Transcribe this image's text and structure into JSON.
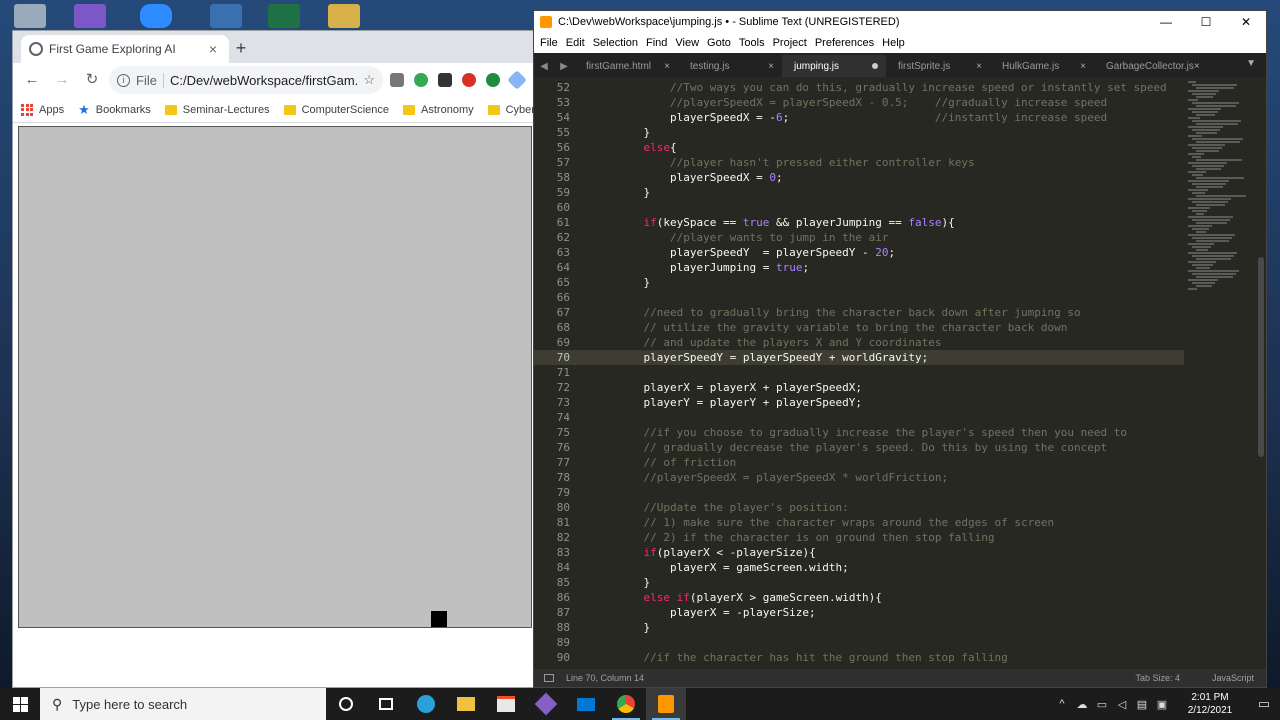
{
  "desktop": {
    "icons": [
      "recycle-bin-icon",
      "visual-studio-icon",
      "zoom-icon",
      "monitor-icon",
      "excel-icon",
      "folder-icon"
    ]
  },
  "chrome": {
    "tab_title": "First Game Exploring AI",
    "tab_close": "×",
    "new_tab": "+",
    "back": "←",
    "forward": "→",
    "reload": "↻",
    "address_label": "File",
    "address_url": "C:/Dev/webWorkspace/firstGam...",
    "bookmark_star": "☆",
    "bookmarks": [
      {
        "label": "Apps"
      },
      {
        "label": "Bookmarks"
      },
      {
        "label": "Seminar-Lectures"
      },
      {
        "label": "ComputerScience"
      },
      {
        "label": "Astronomy"
      },
      {
        "label": "Cybersecu"
      }
    ],
    "game": {
      "background": "#c0c0c0",
      "player_color": "#000000"
    }
  },
  "sublime": {
    "title": "C:\\Dev\\webWorkspace\\jumping.js • - Sublime Text (UNREGISTERED)",
    "window_controls": {
      "minimize": "—",
      "maximize": "☐",
      "close": "✕"
    },
    "menu": [
      "File",
      "Edit",
      "Selection",
      "Find",
      "View",
      "Goto",
      "Tools",
      "Project",
      "Preferences",
      "Help"
    ],
    "tab_nav": {
      "left": "◀",
      "right": "▶",
      "overflow": "▼"
    },
    "tabs": [
      {
        "label": "firstGame.html",
        "active": false
      },
      {
        "label": "testing.js",
        "active": false
      },
      {
        "label": "jumping.js",
        "active": true
      },
      {
        "label": "firstSprite.js",
        "active": false
      },
      {
        "label": "HulkGame.js",
        "active": false
      },
      {
        "label": "GarbageCollector.js",
        "active": false
      }
    ],
    "tab_close": "×",
    "code_lines": [
      {
        "n": "52",
        "text": "        //Two ways you can do this, gradually increase speed or instantly set speed"
      },
      {
        "n": "53",
        "text": "        //playerSpeedX = playerSpeedX - 0.5;    //gradually increase speed"
      },
      {
        "n": "54",
        "text": "        playerSpeedX = -6;                      //instantly increase speed"
      },
      {
        "n": "55",
        "text": "    }"
      },
      {
        "n": "56",
        "text": "    else{"
      },
      {
        "n": "57",
        "text": "        //player hasn't pressed either controller keys"
      },
      {
        "n": "58",
        "text": "        playerSpeedX = 0;"
      },
      {
        "n": "59",
        "text": "    }"
      },
      {
        "n": "60",
        "text": ""
      },
      {
        "n": "61",
        "text": "    if(keySpace == true && playerJumping == false){"
      },
      {
        "n": "62",
        "text": "        //player wants to jump in the air"
      },
      {
        "n": "63",
        "text": "        playerSpeedY  = playerSpeedY - 20;"
      },
      {
        "n": "64",
        "text": "        playerJumping = true;"
      },
      {
        "n": "65",
        "text": "    }"
      },
      {
        "n": "66",
        "text": ""
      },
      {
        "n": "67",
        "text": "    //need to gradually bring the character back down after jumping so"
      },
      {
        "n": "68",
        "text": "    // utilize the gravity variable to bring the character back down"
      },
      {
        "n": "69",
        "text": "    // and update the players X and Y coordinates"
      },
      {
        "n": "70",
        "text": "    playerSpeedY = playerSpeedY + worldGravity;"
      },
      {
        "n": "71",
        "text": ""
      },
      {
        "n": "72",
        "text": "    playerX = playerX + playerSpeedX;"
      },
      {
        "n": "73",
        "text": "    playerY = playerY + playerSpeedY;"
      },
      {
        "n": "74",
        "text": ""
      },
      {
        "n": "75",
        "text": "    //if you choose to gradually increase the player's speed then you need to"
      },
      {
        "n": "76",
        "text": "    // gradually decrease the player's speed. Do this by using the concept"
      },
      {
        "n": "77",
        "text": "    // of friction"
      },
      {
        "n": "78",
        "text": "    //playerSpeedX = playerSpeedX * worldFriction;"
      },
      {
        "n": "79",
        "text": ""
      },
      {
        "n": "80",
        "text": "    //Update the player's position:"
      },
      {
        "n": "81",
        "text": "    // 1) make sure the character wraps around the edges of screen"
      },
      {
        "n": "82",
        "text": "    // 2) if the character is on ground then stop falling"
      },
      {
        "n": "83",
        "text": "    if(playerX < -playerSize){"
      },
      {
        "n": "84",
        "text": "        playerX = gameScreen.width;"
      },
      {
        "n": "85",
        "text": "    }"
      },
      {
        "n": "86",
        "text": "    else if(playerX > gameScreen.width){"
      },
      {
        "n": "87",
        "text": "        playerX = -playerSize;"
      },
      {
        "n": "88",
        "text": "    }"
      },
      {
        "n": "89",
        "text": ""
      },
      {
        "n": "90",
        "text": "    //if the character has hit the ground then stop falling"
      }
    ],
    "current_line": "70",
    "status": {
      "position": "Line 70, Column 14",
      "tab_size": "Tab Size: 4",
      "syntax": "JavaScript"
    }
  },
  "taskbar": {
    "search_placeholder": "Type here to search",
    "apps": [
      "cortana-icon",
      "task-view-icon",
      "edge-icon",
      "file-explorer-icon",
      "store-icon",
      "visual-studio-icon",
      "mail-icon",
      "chrome-icon",
      "sublime-icon"
    ],
    "tray": {
      "chevron": "^",
      "time": "2:01 PM",
      "date": "2/12/2021"
    }
  }
}
